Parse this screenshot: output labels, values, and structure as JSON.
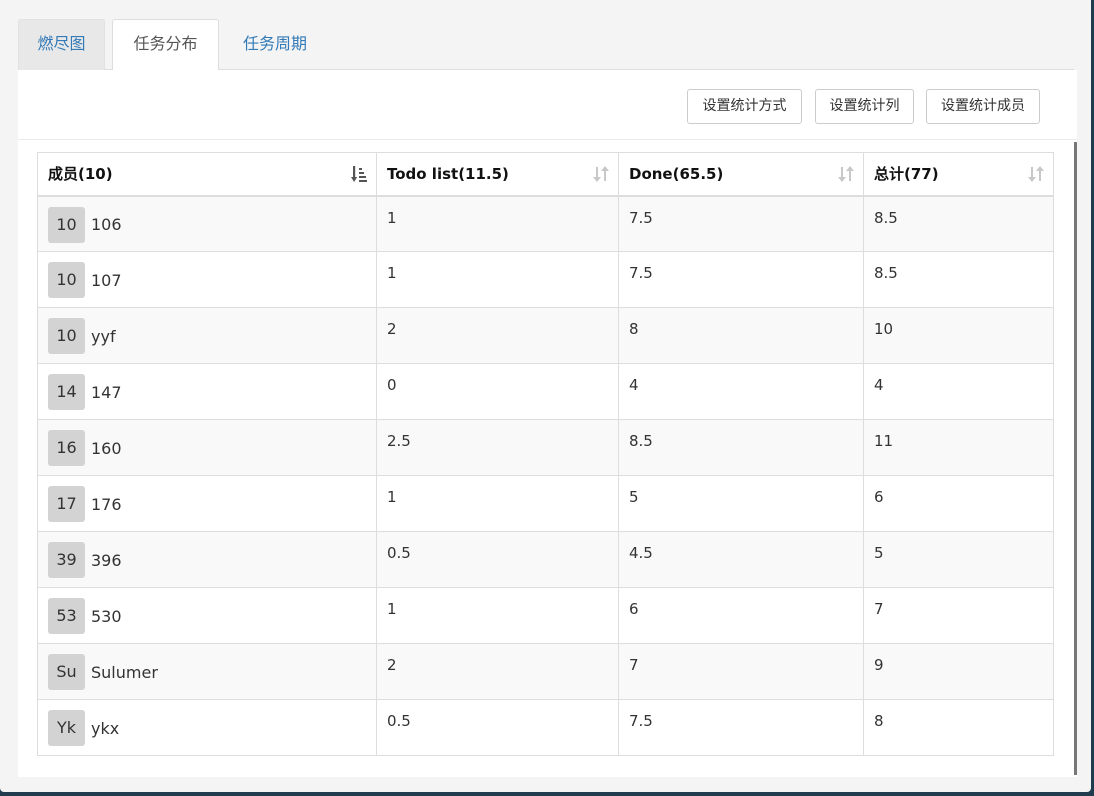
{
  "tabs": [
    {
      "label": "燃尽图"
    },
    {
      "label": "任务分布"
    },
    {
      "label": "任务周期"
    }
  ],
  "active_tab": "任务分布",
  "toolbar": {
    "buttons": [
      {
        "label": "设置统计方式"
      },
      {
        "label": "设置统计列"
      },
      {
        "label": "设置统计成员"
      }
    ]
  },
  "table": {
    "columns": [
      {
        "label": "成员(10)",
        "sort_icon": "sort-amount-down-icon"
      },
      {
        "label": "Todo list(11.5)",
        "sort_icon": "sort-icon"
      },
      {
        "label": "Done(65.5)",
        "sort_icon": "sort-icon"
      },
      {
        "label": "总计(77)",
        "sort_icon": "sort-icon"
      }
    ],
    "rows": [
      {
        "avatar": "10",
        "name": "106",
        "todo": "1",
        "done": "7.5",
        "total": "8.5"
      },
      {
        "avatar": "10",
        "name": "107",
        "todo": "1",
        "done": "7.5",
        "total": "8.5"
      },
      {
        "avatar": "10",
        "name": "yyf",
        "todo": "2",
        "done": "8",
        "total": "10"
      },
      {
        "avatar": "14",
        "name": "147",
        "todo": "0",
        "done": "4",
        "total": "4"
      },
      {
        "avatar": "16",
        "name": "160",
        "todo": "2.5",
        "done": "8.5",
        "total": "11"
      },
      {
        "avatar": "17",
        "name": "176",
        "todo": "1",
        "done": "5",
        "total": "6"
      },
      {
        "avatar": "39",
        "name": "396",
        "todo": "0.5",
        "done": "4.5",
        "total": "5"
      },
      {
        "avatar": "53",
        "name": "530",
        "todo": "1",
        "done": "6",
        "total": "7"
      },
      {
        "avatar": "Su",
        "name": "Sulumer",
        "todo": "2",
        "done": "7",
        "total": "9"
      },
      {
        "avatar": "Yk",
        "name": "ykx",
        "todo": "0.5",
        "done": "7.5",
        "total": "8"
      }
    ]
  },
  "colors": {
    "tab_link": "#337ab7",
    "avatar_bg": "#d3d3d3",
    "stripe": "#f9f9f9",
    "border": "#dddddd"
  }
}
